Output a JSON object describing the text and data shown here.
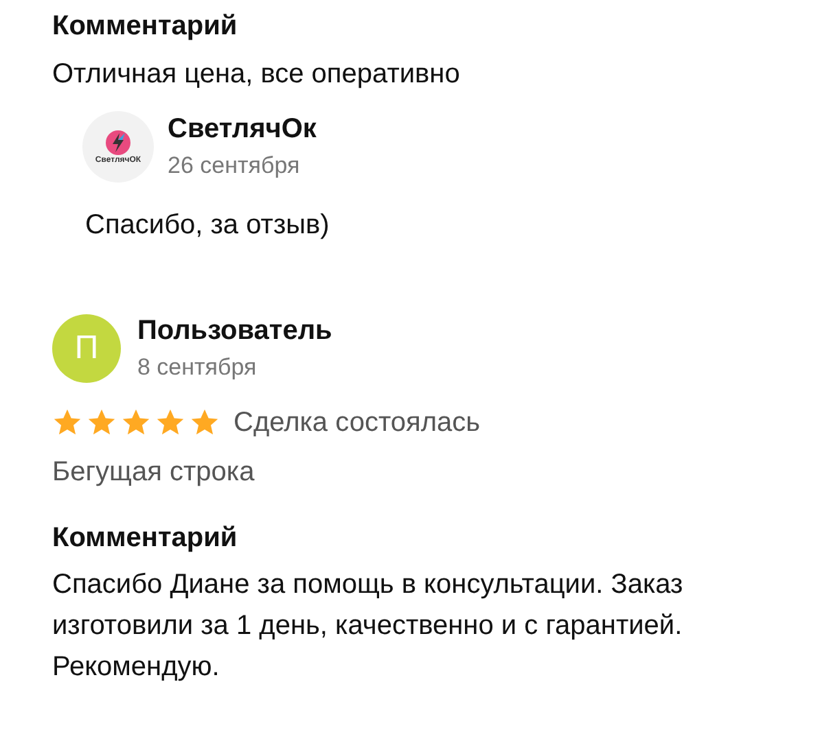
{
  "top_comment": {
    "heading": "Комментарий",
    "text": "Отличная цена, все оперативно"
  },
  "reply": {
    "logo_text": "СветлячОК",
    "author": "СветлячОк",
    "date": "26 сентября",
    "text": "Спасибо, за отзыв)"
  },
  "review": {
    "avatar_letter": "П",
    "author": "Пользователь",
    "date": "8 сентября",
    "stars": 5,
    "deal_status": "Сделка состоялась",
    "item": "Бегущая строка",
    "comment_heading": "Комментарий",
    "comment": "Спасибо Диане за помощь в консультации. Заказ изготовили за 1 день, качественно и с гарантией. Рекомендую."
  }
}
